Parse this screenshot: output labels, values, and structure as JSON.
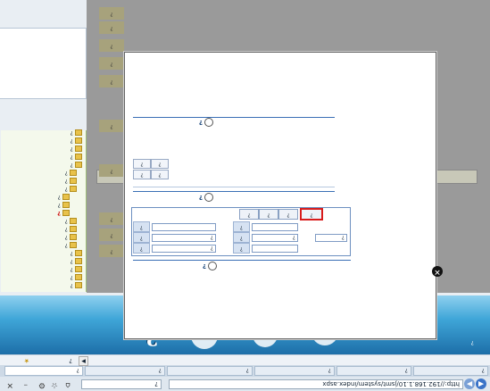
{
  "browser": {
    "address": "http://192.168.1.10/jsmt/system/index.aspx",
    "search_placeholder": "?",
    "tabs": [
      "?",
      "?",
      "?",
      "?",
      "?",
      "?"
    ],
    "fav_label": "?"
  },
  "banner": {
    "title": "?",
    "subtitle": "?",
    "english": "?",
    "welcome": "?"
  },
  "sidebar": {
    "items": [
      "?",
      "?",
      "?",
      "?",
      "?",
      "?",
      "?",
      "?",
      "?",
      "?",
      "?",
      "?",
      "?",
      "?",
      "?",
      "?",
      "?",
      "?",
      "?",
      "?"
    ],
    "selected_index": 9
  },
  "backdrop": {
    "row_labels": [
      "?",
      "?",
      "?",
      "?",
      "?",
      "?",
      "?",
      "?",
      "?",
      "?"
    ],
    "band_text": "?"
  },
  "modal": {
    "section_search": "?",
    "section_list": "?",
    "form": {
      "labels": [
        "?",
        "?",
        "?",
        "?",
        "?",
        "?"
      ],
      "values": [
        "?",
        "?",
        "?",
        "?",
        "",
        ""
      ],
      "buttons": [
        "?",
        "?",
        "?",
        "?"
      ]
    },
    "mini_buttons": [
      "?",
      "?",
      "?",
      "?"
    ],
    "section_result": "?"
  },
  "colors": {
    "accent": "#1d6ea8",
    "highlight": "#d81b1b",
    "sidebar_border": "#9fbf7a"
  }
}
